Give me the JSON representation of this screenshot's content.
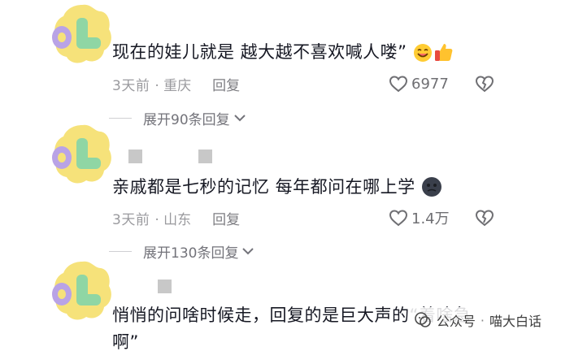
{
  "comments": [
    {
      "text": "现在的娃儿就是 越大越不喜欢喊人喽”",
      "time": "3天前",
      "location": "· 重庆",
      "reply_label": "回复",
      "likes": "6977",
      "expand_label": "展开90条回复",
      "emojis": [
        "smile-emoji",
        "thumbs-up-emoji"
      ]
    },
    {
      "text": "亲戚都是七秒的记忆 每年都问在哪上学",
      "time": "3天前",
      "location": "· 山东",
      "reply_label": "回复",
      "likes": "1.4万",
      "expand_label": "展开130条回复",
      "emojis": [
        "dark-face-emoji"
      ]
    },
    {
      "text_line1": "悄悄的问啥时候走，回复的是巨大声的“着啥急",
      "text_line2": "啊”"
    }
  ],
  "watermark": {
    "channel": "公众号",
    "separator": "·",
    "name": "喵大白话"
  },
  "colors": {
    "avatar_yellow": "#f6e27a",
    "avatar_purple": "#b9a3e6",
    "avatar_green": "#8fd6a4",
    "meta_gray": "#9a9a9e"
  }
}
